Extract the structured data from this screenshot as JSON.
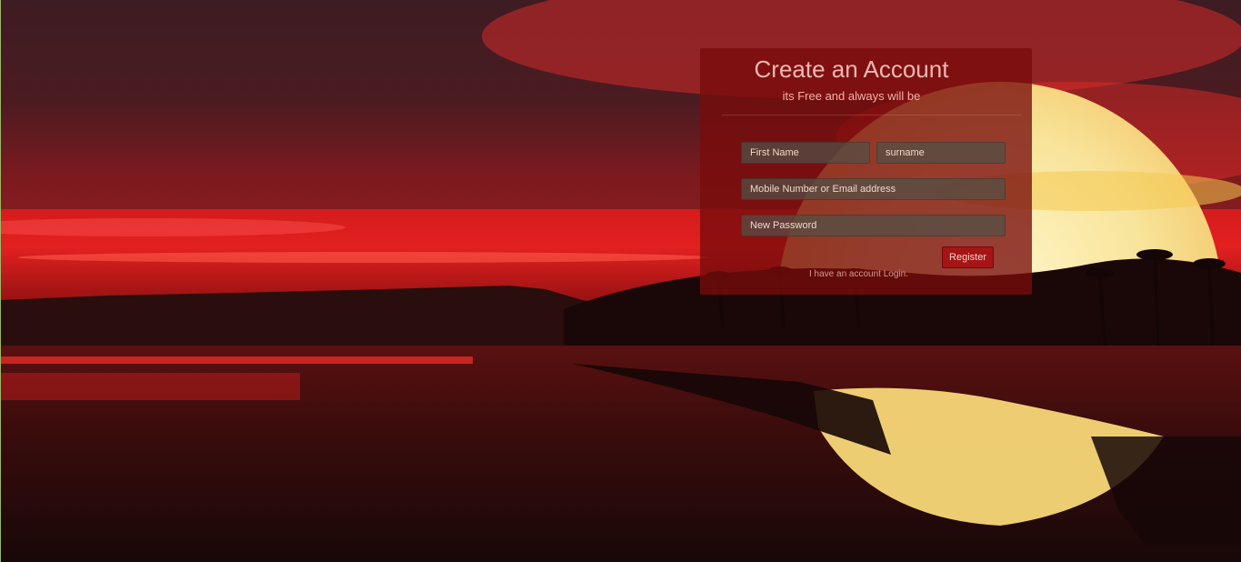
{
  "form": {
    "title": "Create an Account",
    "subtitle": "its Free and always will be",
    "first_name_placeholder": "First Name",
    "surname_placeholder": "surname",
    "contact_placeholder": "Mobile Number or Email address",
    "password_placeholder": "New Password",
    "register_label": "Register",
    "login_link": "I have an account Login."
  },
  "colors": {
    "panel": "#7a0c0c",
    "register_button": "#a51515",
    "sky": "#e32020",
    "sun": "#f5e6a0"
  }
}
